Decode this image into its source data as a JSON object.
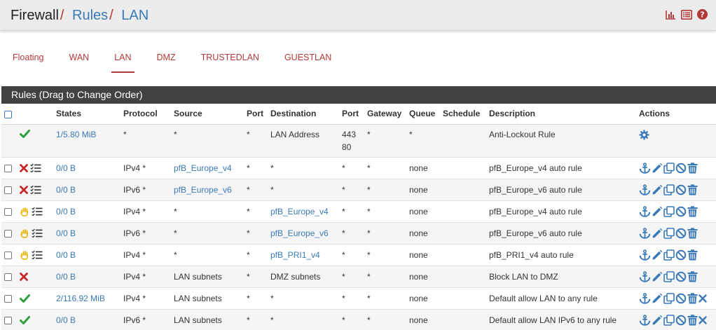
{
  "breadcrumb": {
    "root": "Firewall",
    "sep": "/",
    "rules": "Rules",
    "current": "LAN"
  },
  "tabs": [
    "Floating",
    "WAN",
    "LAN",
    "DMZ",
    "TRUSTEDLAN",
    "GUESTLAN"
  ],
  "active_tab": "LAN",
  "panel_title": "Rules (Drag to Change Order)",
  "columns": [
    "States",
    "Protocol",
    "Source",
    "Port",
    "Destination",
    "Port",
    "Gateway",
    "Queue",
    "Schedule",
    "Description",
    "Actions"
  ],
  "colors": {
    "accent": "#b53838",
    "link": "#3a7ab8",
    "pass": "#2e9e3e",
    "block": "#c62828",
    "reject": "#e8b400"
  },
  "anti_lockout": {
    "states": "1/5.80 MiB",
    "protocol": "*",
    "source": "*",
    "port": "*",
    "destination": "LAN Address",
    "dest_port_1": "443",
    "dest_port_2": "80",
    "gateway": "*",
    "queue": "*",
    "schedule": "",
    "description": "Anti-Lockout Rule"
  },
  "rules": [
    {
      "status": "block",
      "log": true,
      "states": "0/0 B",
      "protocol": "IPv4 *",
      "source": "pfB_Europe_v4",
      "source_link": true,
      "port": "*",
      "destination": "*",
      "dest_link": false,
      "dest_port": "*",
      "gateway": "*",
      "queue": "none",
      "schedule": "",
      "description": "pfB_Europe_v4 auto rule",
      "delete_x": false
    },
    {
      "status": "block",
      "log": true,
      "states": "0/0 B",
      "protocol": "IPv6 *",
      "source": "pfB_Europe_v6",
      "source_link": true,
      "port": "*",
      "destination": "*",
      "dest_link": false,
      "dest_port": "*",
      "gateway": "*",
      "queue": "none",
      "schedule": "",
      "description": "pfB_Europe_v6 auto rule",
      "delete_x": false
    },
    {
      "status": "reject",
      "log": true,
      "states": "0/0 B",
      "protocol": "IPv4 *",
      "source": "*",
      "source_link": false,
      "port": "*",
      "destination": "pfB_Europe_v4",
      "dest_link": true,
      "dest_port": "*",
      "gateway": "*",
      "queue": "none",
      "schedule": "",
      "description": "pfB_Europe_v4 auto rule",
      "delete_x": false
    },
    {
      "status": "reject",
      "log": true,
      "states": "0/0 B",
      "protocol": "IPv6 *",
      "source": "*",
      "source_link": false,
      "port": "*",
      "destination": "pfB_Europe_v6",
      "dest_link": true,
      "dest_port": "*",
      "gateway": "*",
      "queue": "none",
      "schedule": "",
      "description": "pfB_Europe_v6 auto rule",
      "delete_x": false
    },
    {
      "status": "reject",
      "log": true,
      "states": "0/0 B",
      "protocol": "IPv4 *",
      "source": "*",
      "source_link": false,
      "port": "*",
      "destination": "pfB_PRI1_v4",
      "dest_link": true,
      "dest_port": "*",
      "gateway": "*",
      "queue": "none",
      "schedule": "",
      "description": "pfB_PRI1_v4 auto rule",
      "delete_x": false
    },
    {
      "status": "block",
      "log": false,
      "states": "0/0 B",
      "protocol": "IPv4 *",
      "source": "LAN subnets",
      "source_link": false,
      "port": "*",
      "destination": "DMZ subnets",
      "dest_link": false,
      "dest_port": "*",
      "gateway": "*",
      "queue": "none",
      "schedule": "",
      "description": "Block LAN to DMZ",
      "delete_x": false
    },
    {
      "status": "pass",
      "log": false,
      "states": "2/116.92 MiB",
      "protocol": "IPv4 *",
      "source": "LAN subnets",
      "source_link": false,
      "port": "*",
      "destination": "*",
      "dest_link": false,
      "dest_port": "*",
      "gateway": "*",
      "queue": "none",
      "schedule": "",
      "description": "Default allow LAN to any rule",
      "delete_x": true
    },
    {
      "status": "pass",
      "log": false,
      "states": "0/0 B",
      "protocol": "IPv6 *",
      "source": "LAN subnets",
      "source_link": false,
      "port": "*",
      "destination": "*",
      "dest_link": false,
      "dest_port": "*",
      "gateway": "*",
      "queue": "none",
      "schedule": "",
      "description": "Default allow LAN IPv6 to any rule",
      "delete_x": true
    }
  ]
}
